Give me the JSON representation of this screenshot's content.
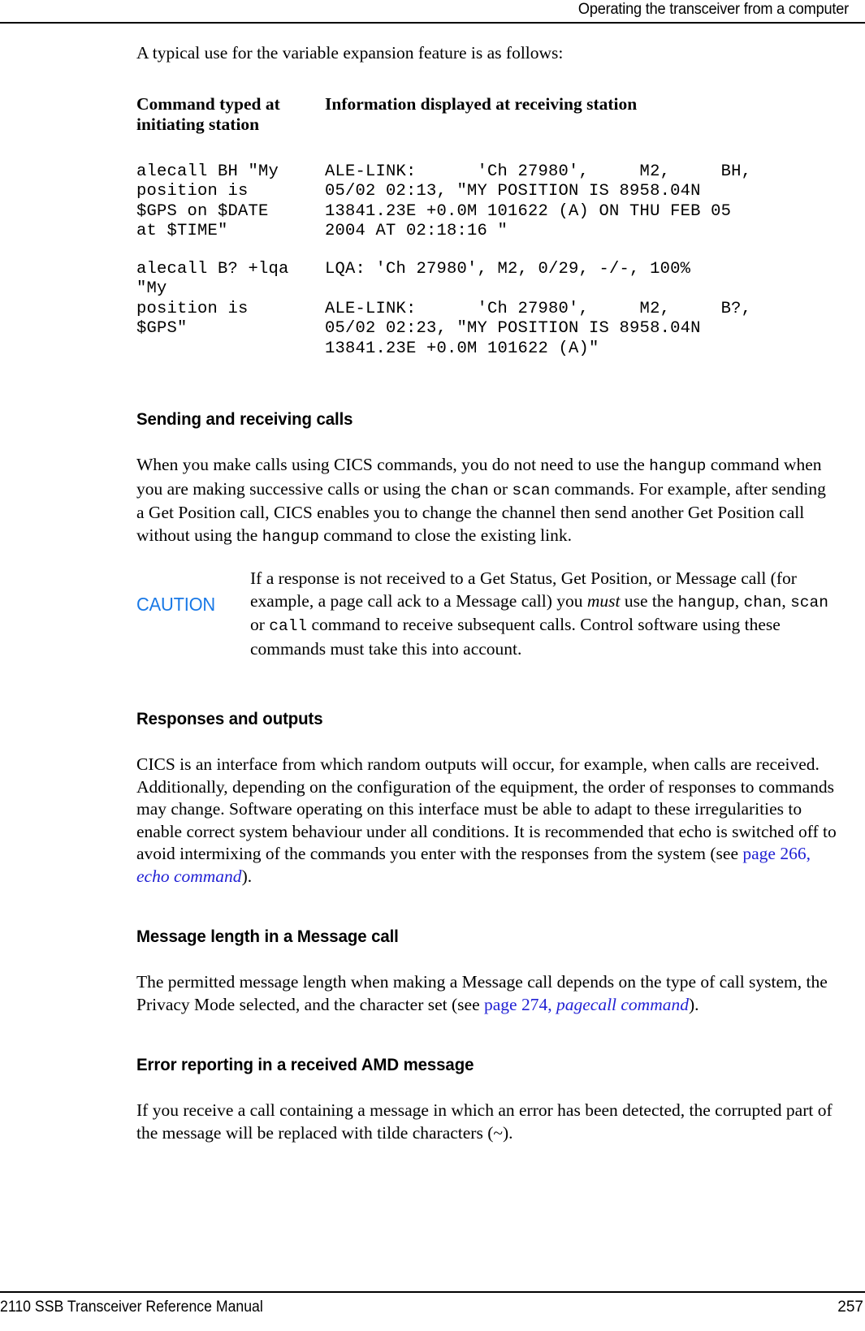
{
  "header": {
    "running_title": "Operating the transceiver from a computer"
  },
  "intro": {
    "text": "A typical use for the variable expansion feature is as follows:"
  },
  "command_table": {
    "columns": [
      "Command typed at initiating station",
      "Information displayed at receiving station"
    ],
    "rows": [
      {
        "command": "alecall BH \"My\nposition is\n$GPS on $DATE\nat $TIME\"",
        "response": "ALE-LINK:      'Ch 27980',     M2,     BH,\n05/02 02:13, \"MY POSITION IS 8958.04N\n13841.23E +0.0M 101622 (A) ON THU FEB 05\n2004 AT 02:18:16 \""
      },
      {
        "command": "alecall B? +lqa\n\"My\nposition is\n$GPS\"",
        "response": "LQA: 'Ch 27980', M2, 0/29, -/-, 100%\n\nALE-LINK:      'Ch 27980',     M2,     B?,\n05/02 02:23, \"MY POSITION IS 8958.04N\n13841.23E +0.0M 101622 (A)\""
      }
    ]
  },
  "sections": [
    {
      "id": "sending-receiving",
      "heading": "Sending and receiving calls",
      "paragraph_parts": [
        {
          "t": "text",
          "v": "When you make calls using CICS commands, you do not need to use the "
        },
        {
          "t": "mono",
          "v": "hangup"
        },
        {
          "t": "text",
          "v": " command when you are making successive calls or using the "
        },
        {
          "t": "mono",
          "v": "chan"
        },
        {
          "t": "text",
          "v": " or "
        },
        {
          "t": "mono",
          "v": "scan"
        },
        {
          "t": "text",
          "v": " commands. For example, after sending a Get Position call, CICS enables you to change the channel then send another Get Position call without using the "
        },
        {
          "t": "mono",
          "v": "hangup"
        },
        {
          "t": "text",
          "v": " command to close the existing link."
        }
      ]
    },
    {
      "id": "responses-outputs",
      "heading": "Responses and outputs"
    },
    {
      "id": "message-length",
      "heading": "Message length in a Message call"
    },
    {
      "id": "error-reporting",
      "heading": "Error reporting in a received AMD message"
    }
  ],
  "sending_paragraph": {
    "seg1": "When you make calls using CICS commands, you do not need to use the ",
    "mono1": "hangup",
    "seg2": " command when you are making successive calls or using the ",
    "mono2": "chan",
    "seg3": " or ",
    "mono3": "scan",
    "seg4": " commands. For example, after sending a Get Position call, CICS enables you to change the channel then send another Get Position call without using the ",
    "mono4": "hangup",
    "seg5": " command to close the existing link."
  },
  "caution": {
    "label": "CAUTION",
    "label_color": "#1878E6",
    "seg1": "If a response is not received to a Get Status, Get Position, or Message call (for example, a page call ack to a Message call) you ",
    "italic1": "must",
    "seg2": " use the ",
    "mono1": "hangup",
    "seg3": ", ",
    "mono2": "chan",
    "seg4": ", ",
    "mono3": "scan",
    "seg5": " or ",
    "mono4": "call",
    "seg6": " command to receive subsequent calls. Control software using these commands must take this into account."
  },
  "responses_paragraph": {
    "seg1": "CICS is an interface from which random outputs will occur, for example, when calls are received. Additionally, depending on the configuration of the equipment, the order of responses to commands may change. Software operating on this interface must be able to adapt to these irregularities to enable correct system behaviour under all conditions. It is recommended that echo is switched off to avoid intermixing of the commands you enter with the responses from the system (see ",
    "link_page": "page 266",
    "link_sep": ", ",
    "link_title": "echo command",
    "seg2": ")."
  },
  "message_length_paragraph": {
    "seg1": "The permitted message length when making a Message call depends on the type of call system, the Privacy Mode selected, and the character set (see ",
    "link_page": "page 274",
    "link_sep": ", ",
    "link_title": "pagecall command",
    "seg2": ")."
  },
  "error_reporting_paragraph": {
    "text": "If you receive a call containing a message in which an error has been detected, the corrupted part of the message will be replaced with tilde characters (~)."
  },
  "footer": {
    "left": "2110 SSB Transceiver Reference Manual",
    "page_number": "257"
  }
}
